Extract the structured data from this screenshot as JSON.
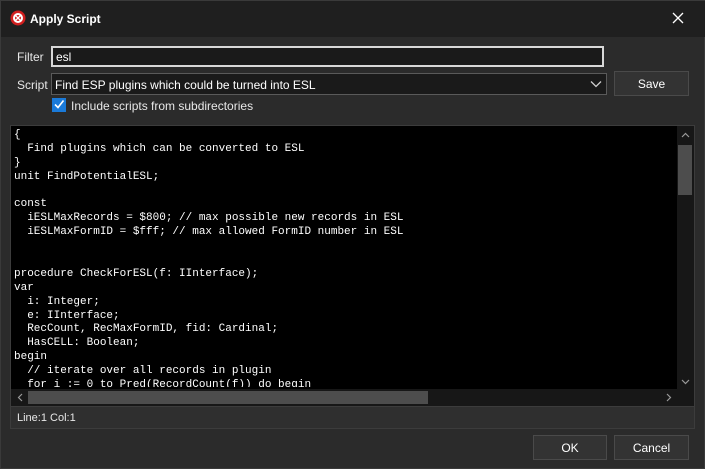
{
  "window": {
    "title": "Apply Script"
  },
  "filter": {
    "label": "Filter",
    "value": "esl"
  },
  "script": {
    "label": "Script",
    "selected": "Find ESP plugins which could be turned into ESL",
    "save_label": "Save"
  },
  "include_subdirs": {
    "label": "Include scripts from subdirectories",
    "checked": true
  },
  "editor": {
    "lines": [
      "{",
      "  Find plugins which can be converted to ESL",
      "}",
      "unit FindPotentialESL;",
      "",
      "const",
      "  iESLMaxRecords = $800; // max possible new records in ESL",
      "  iESLMaxFormID = $fff; // max allowed FormID number in ESL",
      "",
      "",
      "procedure CheckForESL(f: IInterface);",
      "var",
      "  i: Integer;",
      "  e: IInterface;",
      "  RecCount, RecMaxFormID, fid: Cardinal;",
      "  HasCELL: Boolean;",
      "begin",
      "  // iterate over all records in plugin",
      "  for i := 0 to Pred(RecordCount(f)) do begin"
    ]
  },
  "status": {
    "position": "Line:1 Col:1"
  },
  "footer": {
    "ok_label": "OK",
    "cancel_label": "Cancel"
  },
  "colors": {
    "accent": "#1a7ad9",
    "background": "#2b2b2b",
    "editor_bg": "#000000"
  }
}
